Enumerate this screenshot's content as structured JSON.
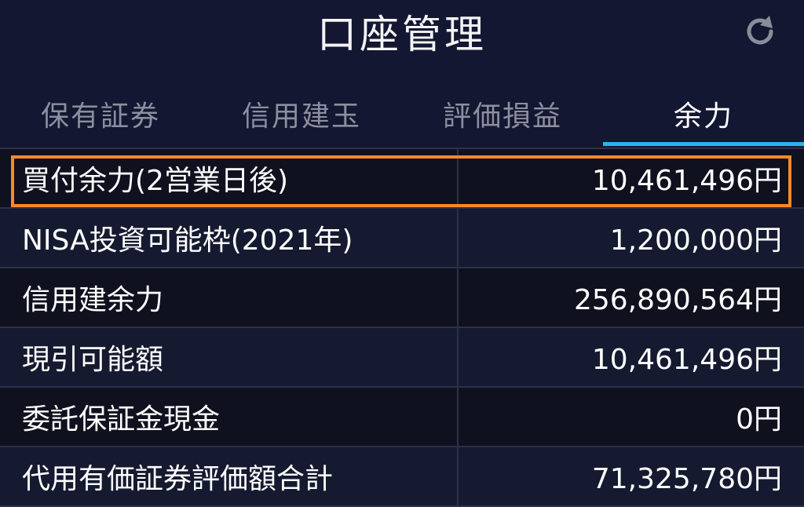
{
  "header": {
    "title": "口座管理",
    "refresh_icon": "refresh-icon"
  },
  "tabs": [
    {
      "label": "保有証券",
      "active": false
    },
    {
      "label": "信用建玉",
      "active": false
    },
    {
      "label": "評価損益",
      "active": false
    },
    {
      "label": "余力",
      "active": true
    }
  ],
  "rows": [
    {
      "label": "買付余力(2営業日後)",
      "value": "10,461,496円",
      "highlighted": true
    },
    {
      "label": "NISA投資可能枠(2021年)",
      "value": "1,200,000円"
    },
    {
      "label": "信用建余力",
      "value": "256,890,564円"
    },
    {
      "label": "現引可能額",
      "value": "10,461,496円"
    },
    {
      "label": "委託保証金現金",
      "value": "0円"
    },
    {
      "label": "代用有価証券評価額合計",
      "value": "71,325,780円"
    }
  ],
  "colors": {
    "background": "#141731",
    "active_tab_underline": "#2ab3ec",
    "highlight_border": "#f58a2a"
  }
}
